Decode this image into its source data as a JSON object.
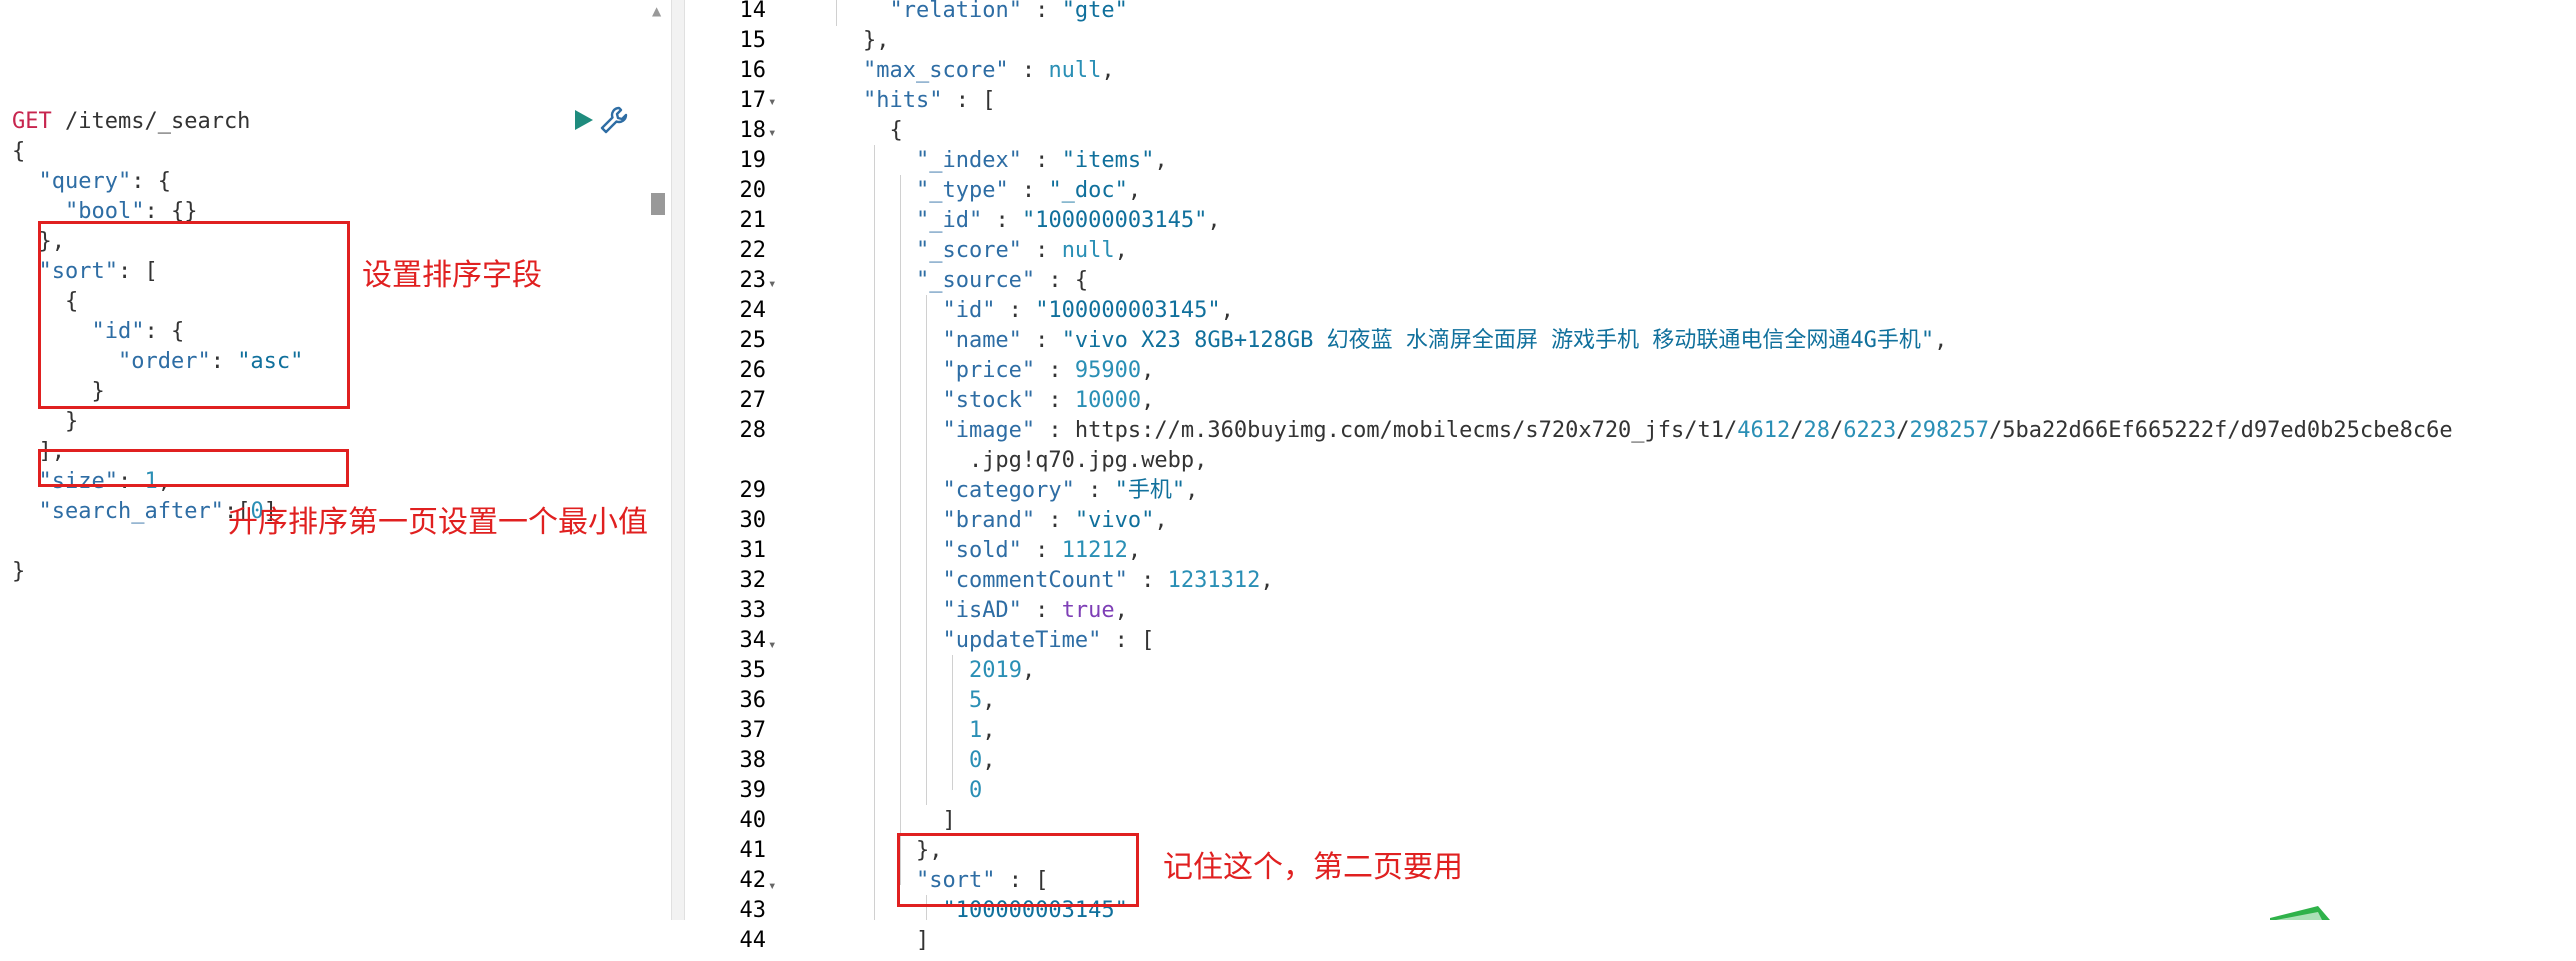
{
  "request": {
    "method": "GET",
    "path": "/items/_search",
    "lines": [
      "{",
      "  \"query\": {",
      "    \"bool\": {}",
      "  },",
      "  \"sort\": [",
      "    {",
      "      \"id\": {",
      "        \"order\": \"asc\"",
      "      }",
      "    }",
      "  ],",
      "  \"size\": 1,",
      "  \"search_after\":[0]",
      "",
      "}"
    ]
  },
  "response": {
    "line_numbers": [
      "14",
      "15",
      "16",
      "17",
      "18",
      "19",
      "20",
      "21",
      "22",
      "23",
      "24",
      "25",
      "26",
      "27",
      "28",
      "",
      "29",
      "30",
      "31",
      "32",
      "33",
      "34",
      "35",
      "36",
      "37",
      "38",
      "39",
      "40",
      "41",
      "42",
      "43",
      "44"
    ],
    "lines": [
      "      \"relation\" : \"gte\"",
      "    },",
      "    \"max_score\" : null,",
      "    \"hits\" : [",
      "      {",
      "        \"_index\" : \"items\",",
      "        \"_type\" : \"_doc\",",
      "        \"_id\" : \"100000003145\",",
      "        \"_score\" : null,",
      "        \"_source\" : {",
      "          \"id\" : \"100000003145\",",
      "          \"name\" : \"vivo X23 8GB+128GB 幻夜蓝 水滴屏全面屏 游戏手机 移动联通电信全网通4G手机\",",
      "          \"price\" : 95900,",
      "          \"stock\" : 10000,",
      "          \"image\" : \"https://m.360buyimg.com/mobilecms/s720x720_jfs/t1/4612/28/6223/298257/5ba22d66Ef665222f/d97ed0b25cbe8c6e",
      "            .jpg!q70.jpg.webp\",",
      "          \"category\" : \"手机\",",
      "          \"brand\" : \"vivo\",",
      "          \"sold\" : 11212,",
      "          \"commentCount\" : 1231312,",
      "          \"isAD\" : true,",
      "          \"updateTime\" : [",
      "            2019,",
      "            5,",
      "            1,",
      "            0,",
      "            0",
      "          ]",
      "        },",
      "        \"sort\" : [",
      "          \"100000003145\"",
      "        ]"
    ]
  },
  "annotations": {
    "sort_field": "设置排序字段",
    "first_page_min": "升序排序第一页设置一个最小值",
    "remember_sort": "记住这个，第二页要用"
  },
  "icons": {
    "run": "play-icon",
    "settings": "wrench-icon"
  },
  "colors": {
    "run_icon": "#1f8c7e",
    "wrench_icon": "#2e6da4",
    "annotation": "#e02020",
    "method": "#c7254e"
  }
}
